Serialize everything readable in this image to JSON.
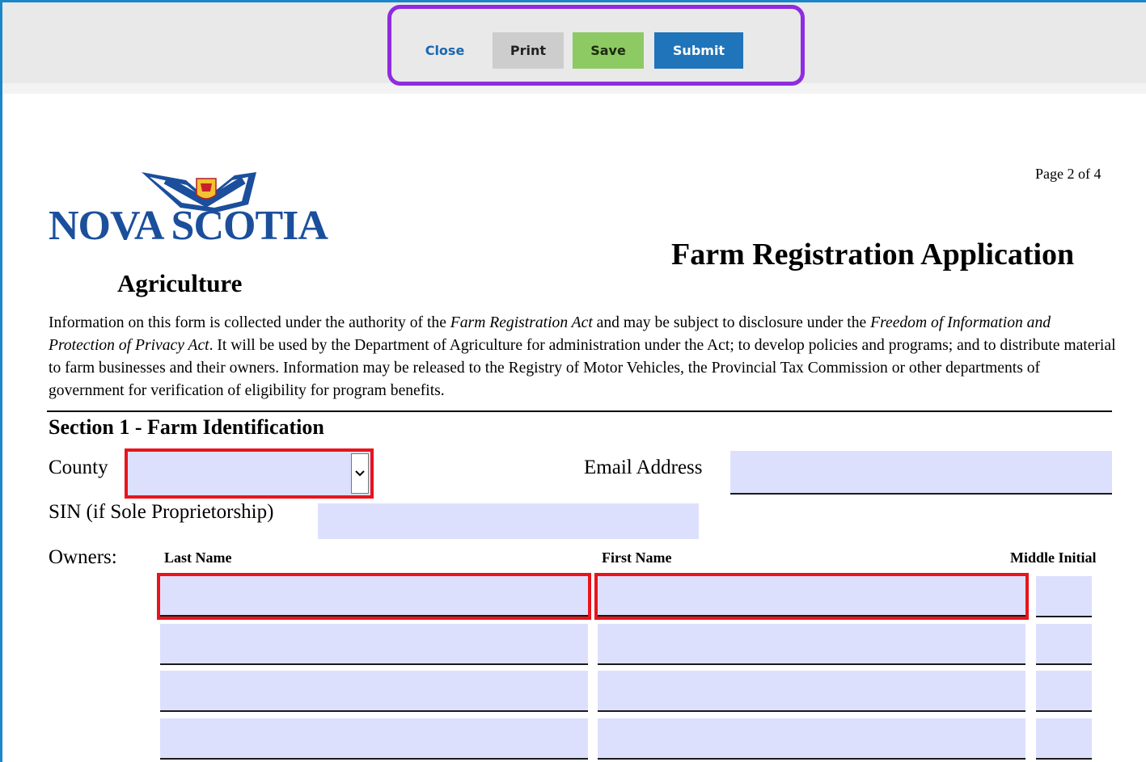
{
  "toolbar": {
    "close_label": "Close",
    "print_label": "Print",
    "save_label": "Save",
    "submit_label": "Submit"
  },
  "header": {
    "logo_text": "NOVA SCOTIA",
    "department": "Agriculture",
    "page_indicator": "Page 2 of 4",
    "form_title": "Farm Registration Application"
  },
  "intro": {
    "part1": "Information on this form is collected under the authority of the ",
    "act1": "Farm Registration Act",
    "part2": " and may be subject to disclosure under the ",
    "act2": "Freedom of Information and Protection of Privacy Act",
    "part3": ". It will be used by the Department of Agriculture for administration under the Act; to develop policies and programs; and to distribute material to farm businesses and their owners. Information may be released to the Registry of Motor Vehicles, the Provincial Tax Commission or other departments of government for verification of eligibility for program benefits."
  },
  "section1": {
    "title": "Section 1 - Farm Identification",
    "county_label": "County",
    "county_value": "",
    "email_label": "Email Address",
    "email_value": "",
    "sin_label": "SIN (if Sole Proprietorship)",
    "sin_value": "",
    "owners_label": "Owners:",
    "columns": [
      "Last Name",
      "First Name",
      "Middle Initial"
    ],
    "owner_rows": [
      {
        "last": "",
        "first": "",
        "middle": "",
        "required": true
      },
      {
        "last": "",
        "first": "",
        "middle": "",
        "required": false
      },
      {
        "last": "",
        "first": "",
        "middle": "",
        "required": false
      },
      {
        "last": "",
        "first": "",
        "middle": "",
        "required": false
      }
    ]
  },
  "colors": {
    "accent_border": "#1a87c8",
    "toolbar_highlight": "#8f2be0",
    "field_bg": "#dde0fd",
    "required_outline": "#e8141c",
    "submit_bg": "#1f74ba",
    "save_bg": "#8dca63",
    "print_bg": "#cdcdcd",
    "logo_blue": "#1b4f9c"
  },
  "icons": {
    "dropdown": "chevron-down-icon",
    "logo": "nova-scotia-flag-icon"
  }
}
